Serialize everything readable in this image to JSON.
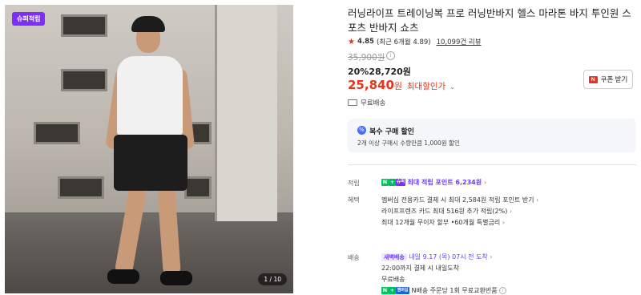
{
  "gallery": {
    "badge": "슈퍼적립",
    "counter": "1 / 10"
  },
  "product": {
    "title": "러닝라이프 트레이닝복 프로 러닝반바지 헬스 마라톤 바지 투인원 스포츠 반바지 쇼츠"
  },
  "rating": {
    "score": "4.85",
    "recent": "(최근 6개월 4.89)",
    "reviews": "10,099건 리뷰"
  },
  "price": {
    "original": "35,900원",
    "discount_pct": "20%",
    "sale": "28,720원",
    "max_price": "25,840",
    "max_won": "원",
    "max_label": "최대할인가",
    "coupon_label": "쿠폰 받기"
  },
  "shipping": {
    "label": "무료배송"
  },
  "multi_purchase": {
    "heading": "복수 구매 할인",
    "detail": "2개 이상 구매시 수량만큼 1,000원 할인"
  },
  "points": {
    "label": "적립",
    "text": "최대 적립 포인트 6,234원"
  },
  "benefits": {
    "label": "혜택",
    "lines": [
      "멤버십 전용카드 결제 시 최대 2,584원 적립 포인트 받기",
      "라이프프렌즈 카드 최대 516원 추가 적립(2%)",
      "최대 12개월 무이자 할부 •60개월 특별금리"
    ]
  },
  "delivery": {
    "label": "배송",
    "badge": "새벽배송",
    "eta": "내일 9.17 (목) 07시 전 도착",
    "cutoff": "22:00까지 결제 시 내일도착",
    "fee": "무료배송",
    "return": "N배송 주문당 1회 무료교환반품"
  },
  "icons": {
    "n_logo": "N",
    "plus_logo": "+",
    "super_logo": "슈퍼",
    "membership_logo": "멤버십",
    "coupon_logo": "N",
    "info": "i",
    "discount_icon": "%"
  },
  "colors": {
    "accent_red": "#e8331e",
    "accent_purple": "#6b3df5",
    "naver_green": "#03c75a",
    "badge_purple": "#7b2ff7"
  }
}
